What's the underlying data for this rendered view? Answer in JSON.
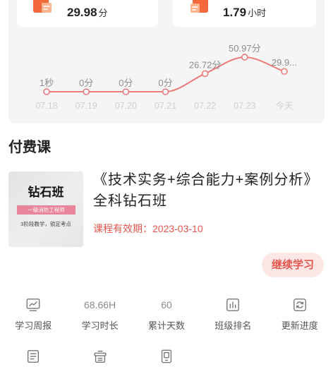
{
  "theme": {
    "accent": "#e4574f",
    "accent_soft": "#fde7e4",
    "orange": "#f4693c"
  },
  "summary_cards": [
    {
      "icon": "file-icon",
      "value": "29.98",
      "unit": "分"
    },
    {
      "icon": "book-icon",
      "value": "1.79",
      "unit": "小时"
    }
  ],
  "chart_data": {
    "type": "line",
    "title": "",
    "xlabel": "",
    "ylabel": "",
    "x": [
      "07.18",
      "07.19",
      "07.20",
      "07.21",
      "07.22",
      "07.23",
      "今天"
    ],
    "values": [
      0.017,
      0,
      0,
      0,
      26.72,
      50.97,
      29.9
    ],
    "data_labels": [
      "1秒",
      "0分",
      "0分",
      "0分",
      "26.72分",
      "50.97分",
      "29.9..."
    ],
    "ylim": [
      0,
      60
    ],
    "grid": false,
    "line_color": "#ec7b79"
  },
  "paid_courses": {
    "title": "付费课",
    "course": {
      "thumbnail": {
        "title": "钻石班",
        "banner": "一级消防工程师",
        "tagline": "3阶段教学，锁定考点"
      },
      "name": "《技术实务+综合能力+案例分析》全科钻石班",
      "validity": "课程有效期：2023-03-10",
      "action_label": "继续学习"
    }
  },
  "stats": [
    {
      "icon": "line-chart-icon",
      "label": "学习周报"
    },
    {
      "value": "68.66H",
      "label": "学习时长"
    },
    {
      "value": "60",
      "label": "累计天数"
    },
    {
      "icon": "bar-chart-icon",
      "label": "班级排名"
    },
    {
      "icon": "refresh-icon",
      "label": "更新进度"
    }
  ],
  "tools": [
    {
      "icon": "document-icon"
    },
    {
      "icon": "box-icon"
    },
    {
      "icon": "tablet-icon"
    }
  ]
}
